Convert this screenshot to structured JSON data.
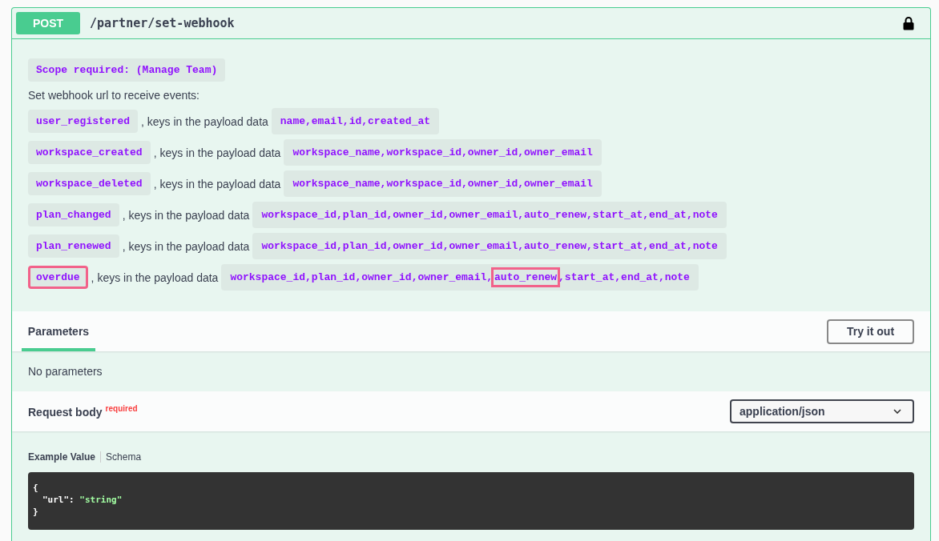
{
  "operation": {
    "method": "POST",
    "path": "/partner/set-webhook",
    "locked": true
  },
  "description": {
    "scope": "Scope required: (Manage Team)",
    "intro": "Set webhook url to receive events:",
    "events": [
      {
        "name": "user_registered",
        "highlighted": false,
        "text": ", keys in the payload data",
        "payload": [
          {
            "text": "name,email,id,created_at",
            "highlighted": false
          }
        ]
      },
      {
        "name": "workspace_created",
        "highlighted": false,
        "text": ", keys in the payload data",
        "payload": [
          {
            "text": "workspace_name,workspace_id,owner_id,owner_email",
            "highlighted": false
          }
        ]
      },
      {
        "name": "workspace_deleted",
        "highlighted": false,
        "text": ", keys in the payload data",
        "payload": [
          {
            "text": "workspace_name,workspace_id,owner_id,owner_email",
            "highlighted": false
          }
        ]
      },
      {
        "name": "plan_changed",
        "highlighted": false,
        "text": ", keys in the payload data",
        "payload": [
          {
            "text": "workspace_id,plan_id,owner_id,owner_email,auto_renew,start_at,end_at,note",
            "highlighted": false
          }
        ]
      },
      {
        "name": "plan_renewed",
        "highlighted": false,
        "text": ", keys in the payload data",
        "payload": [
          {
            "text": "workspace_id,plan_id,owner_id,owner_email,auto_renew,start_at,end_at,note",
            "highlighted": false
          }
        ]
      },
      {
        "name": "overdue",
        "highlighted": true,
        "text": ", keys in the payload data",
        "payload": [
          {
            "text": "workspace_id,plan_id,owner_id,owner_email,",
            "highlighted": false
          },
          {
            "text": "auto_renew",
            "highlighted": true
          },
          {
            "text": ",start_at,end_at,note",
            "highlighted": false
          }
        ]
      }
    ]
  },
  "parameters": {
    "tabs": [
      {
        "label": "Parameters",
        "selected": true
      }
    ],
    "try_button": "Try it out",
    "empty": "No parameters"
  },
  "request_body": {
    "title": "Request body",
    "required": "required",
    "content_type": "application/json",
    "example_tabs": [
      {
        "label": "Example Value",
        "selected": true
      },
      {
        "label": "Schema",
        "selected": false
      }
    ],
    "example_lines": [
      {
        "text": "{"
      },
      {
        "key": "\"url\"",
        "sep": ": ",
        "value": "\"string\""
      },
      {
        "text": "}"
      }
    ]
  }
}
